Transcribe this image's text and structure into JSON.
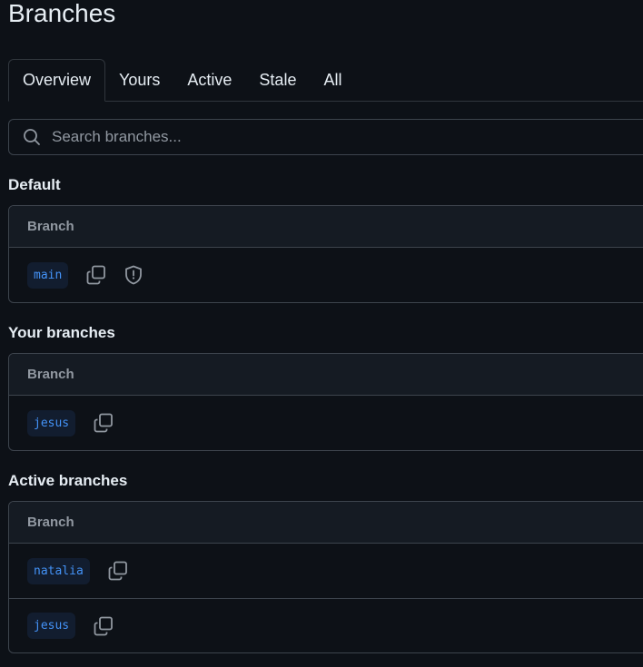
{
  "page": {
    "title": "Branches"
  },
  "tabs": [
    {
      "label": "Overview"
    },
    {
      "label": "Yours"
    },
    {
      "label": "Active"
    },
    {
      "label": "Stale"
    },
    {
      "label": "All"
    }
  ],
  "search": {
    "placeholder": "Search branches...",
    "icon": "search-icon"
  },
  "sections": {
    "default": {
      "title": "Default",
      "column_header": "Branch",
      "rows": [
        {
          "branch": "main",
          "icons": [
            "copy-icon",
            "shield-icon"
          ]
        }
      ]
    },
    "yours": {
      "title": "Your branches",
      "column_header": "Branch",
      "rows": [
        {
          "branch": "jesus",
          "icons": [
            "copy-icon"
          ]
        }
      ]
    },
    "active": {
      "title": "Active branches",
      "column_header": "Branch",
      "rows": [
        {
          "branch": "natalia",
          "icons": [
            "copy-icon"
          ]
        },
        {
          "branch": "jesus",
          "icons": [
            "copy-icon"
          ]
        }
      ]
    }
  },
  "colors": {
    "background": "#0d1117",
    "branch_text": "#4493f8",
    "branch_bg": "#121d2f",
    "border": "#3d444d"
  }
}
